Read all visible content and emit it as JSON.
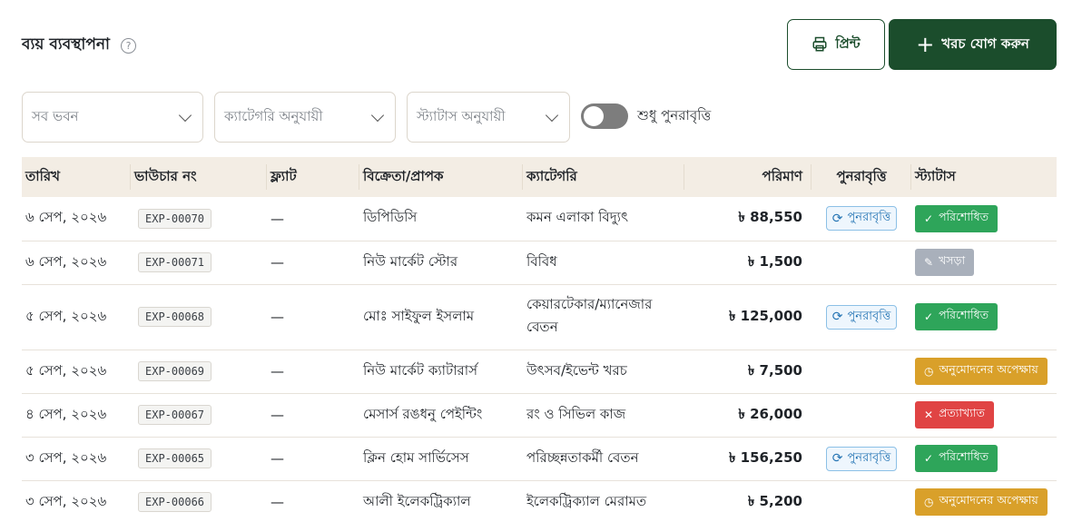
{
  "header": {
    "title": "ব্যয় ব্যবস্থাপনা",
    "help_icon": "question-circle-icon"
  },
  "actions": {
    "print_label": "প্রিন্ট",
    "add_label": "খরচ যোগ করুন"
  },
  "filters": {
    "building": "সব ভবন",
    "category": "ক্যাটেগরি অনুযায়ী",
    "status": "স্ট্যাটাস অনুযায়ী",
    "recurring_only_label": "শুধু পুনরাবৃত্তি",
    "recurring_only": false
  },
  "colors": {
    "brand": "#1b4d2c",
    "paid": "#2ea55a",
    "draft": "#a9b0bb",
    "pending": "#d9a02a",
    "rejected": "#e04444",
    "recurring": "#2474b4"
  },
  "table": {
    "headers": [
      "তারিখ",
      "ভাউচার নং",
      "ফ্ল্যাট",
      "বিক্রেতা/প্রাপক",
      "ক্যাটেগরি",
      "পরিমাণ",
      "পুনরাবৃত্তি",
      "স্ট্যাটাস"
    ],
    "recurring_label": "পুনরাবৃত্তি",
    "rows": [
      {
        "date": "৬ সেপ, ২০২৬",
        "voucher": "EXP-00070",
        "flat": "—",
        "vendor": "ডিপিডিসি",
        "category": "কমন এলাকা বিদ্যুৎ",
        "amount": "৳ 88,550",
        "recurring": "পুনরাবৃত্তি",
        "status": "পরিশোধিত",
        "status_type": "paid"
      },
      {
        "date": "৬ সেপ, ২০২৬",
        "voucher": "EXP-00071",
        "flat": "—",
        "vendor": "নিউ মার্কেট স্টোর",
        "category": "বিবিধ",
        "amount": "৳ 1,500",
        "recurring": "",
        "status": "খসড়া",
        "status_type": "draft"
      },
      {
        "date": "৫ সেপ, ২০২৬",
        "voucher": "EXP-00068",
        "flat": "—",
        "vendor": "মোঃ সাইফুল ইসলাম",
        "category": "কেয়ারটেকার/ম্যানেজার বেতন",
        "amount": "৳ 125,000",
        "recurring": "পুনরাবৃত্তি",
        "status": "পরিশোধিত",
        "status_type": "paid"
      },
      {
        "date": "৫ সেপ, ২০২৬",
        "voucher": "EXP-00069",
        "flat": "—",
        "vendor": "নিউ মার্কেট ক্যাটারার্স",
        "category": "উৎসব/ইভেন্ট খরচ",
        "amount": "৳ 7,500",
        "recurring": "",
        "status": "অনুমোদনের অপেক্ষায়",
        "status_type": "pending"
      },
      {
        "date": "৪ সেপ, ২০২৬",
        "voucher": "EXP-00067",
        "flat": "—",
        "vendor": "মেসার্স রঙধনু পেইন্টিং",
        "category": "রং ও সিভিল কাজ",
        "amount": "৳ 26,000",
        "recurring": "",
        "status": "প্রত্যাখ্যাত",
        "status_type": "rejected"
      },
      {
        "date": "৩ সেপ, ২০২৬",
        "voucher": "EXP-00065",
        "flat": "—",
        "vendor": "ক্লিন হোম সার্ভিসেস",
        "category": "পরিচ্ছন্নতাকর্মী বেতন",
        "amount": "৳ 156,250",
        "recurring": "পুনরাবৃত্তি",
        "status": "পরিশোধিত",
        "status_type": "paid"
      },
      {
        "date": "৩ সেপ, ২০২৬",
        "voucher": "EXP-00066",
        "flat": "—",
        "vendor": "আলী ইলেকট্রিক্যাল",
        "category": "ইলেকট্রিক্যাল মেরামত",
        "amount": "৳ 5,200",
        "recurring": "",
        "status": "অনুমোদনের অপেক্ষায়",
        "status_type": "pending"
      }
    ]
  }
}
